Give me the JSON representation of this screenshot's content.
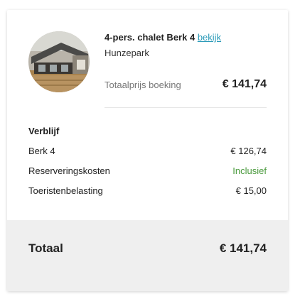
{
  "accommodation": {
    "title": "4-pers. chalet Berk 4",
    "view_link": "bekijk",
    "park": "Hunzepark"
  },
  "booking_total": {
    "label": "Totaalprijs boeking",
    "value": "€ 141,74"
  },
  "stay": {
    "heading": "Verblijf",
    "rows": [
      {
        "label": "Berk 4",
        "value": "€ 126,74"
      },
      {
        "label": "Reserveringskosten",
        "value": "Inclusief"
      },
      {
        "label": "Toeristenbelasting",
        "value": "€ 15,00"
      }
    ]
  },
  "footer": {
    "label": "Totaal",
    "value": "€ 141,74"
  },
  "colors": {
    "link": "#2a9ab8",
    "included": "#4a9a3d",
    "footer_bg": "#efefef"
  }
}
